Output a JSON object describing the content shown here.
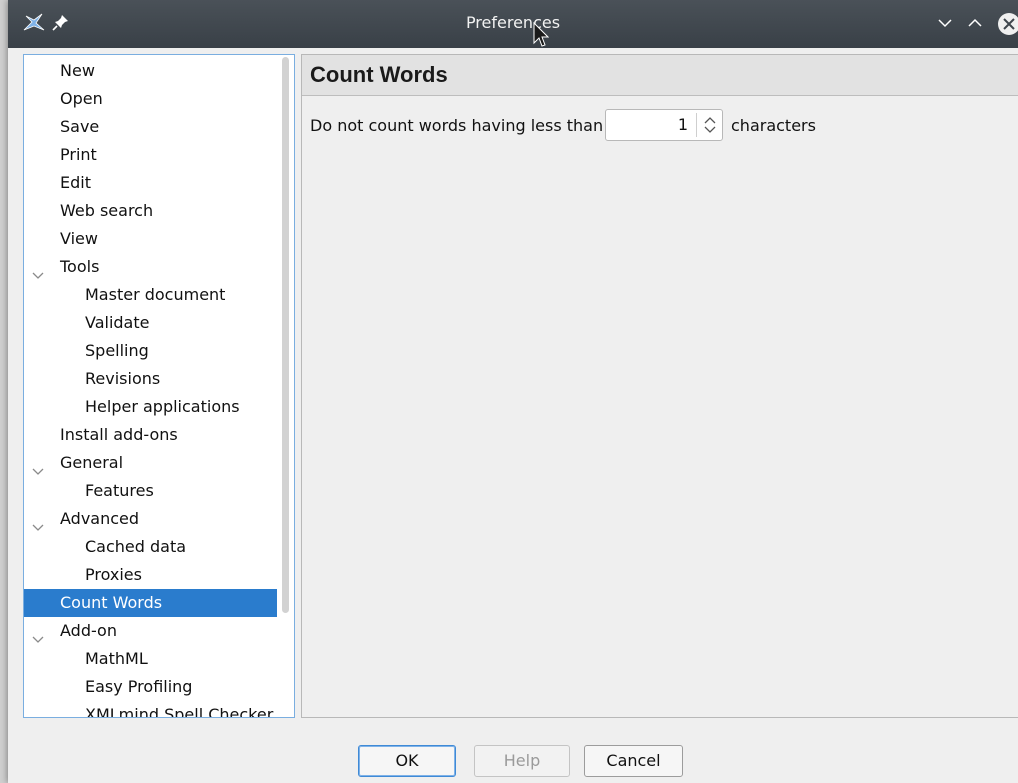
{
  "window": {
    "title": "Preferences"
  },
  "tree": {
    "items": [
      {
        "label": "New",
        "level": 0
      },
      {
        "label": "Open",
        "level": 0
      },
      {
        "label": "Save",
        "level": 0
      },
      {
        "label": "Print",
        "level": 0
      },
      {
        "label": "Edit",
        "level": 0
      },
      {
        "label": "Web search",
        "level": 0
      },
      {
        "label": "View",
        "level": 0
      },
      {
        "label": "Tools",
        "level": 0,
        "expanded": true
      },
      {
        "label": "Master document",
        "level": 1
      },
      {
        "label": "Validate",
        "level": 1
      },
      {
        "label": "Spelling",
        "level": 1
      },
      {
        "label": "Revisions",
        "level": 1
      },
      {
        "label": "Helper applications",
        "level": 1
      },
      {
        "label": "Install add-ons",
        "level": 0
      },
      {
        "label": "General",
        "level": 0,
        "expanded": true
      },
      {
        "label": "Features",
        "level": 1
      },
      {
        "label": "Advanced",
        "level": 0,
        "expanded": true
      },
      {
        "label": "Cached data",
        "level": 1
      },
      {
        "label": "Proxies",
        "level": 1
      },
      {
        "label": "Count Words",
        "level": 0,
        "selected": true
      },
      {
        "label": "Add-on",
        "level": 0,
        "expanded": true
      },
      {
        "label": "MathML",
        "level": 1
      },
      {
        "label": "Easy Profiling",
        "level": 1
      },
      {
        "label": "XMLmind Spell Checker",
        "level": 1
      }
    ]
  },
  "panel": {
    "title": "Count Words",
    "option": {
      "label_before": "Do not count words having less than",
      "value": "1",
      "label_after": "characters"
    }
  },
  "buttons": {
    "ok": "OK",
    "help": "Help",
    "cancel": "Cancel"
  },
  "colors": {
    "selection": "#2a7ccd",
    "titlebar": "#3f464d",
    "focus_border": "#7aaee0"
  }
}
